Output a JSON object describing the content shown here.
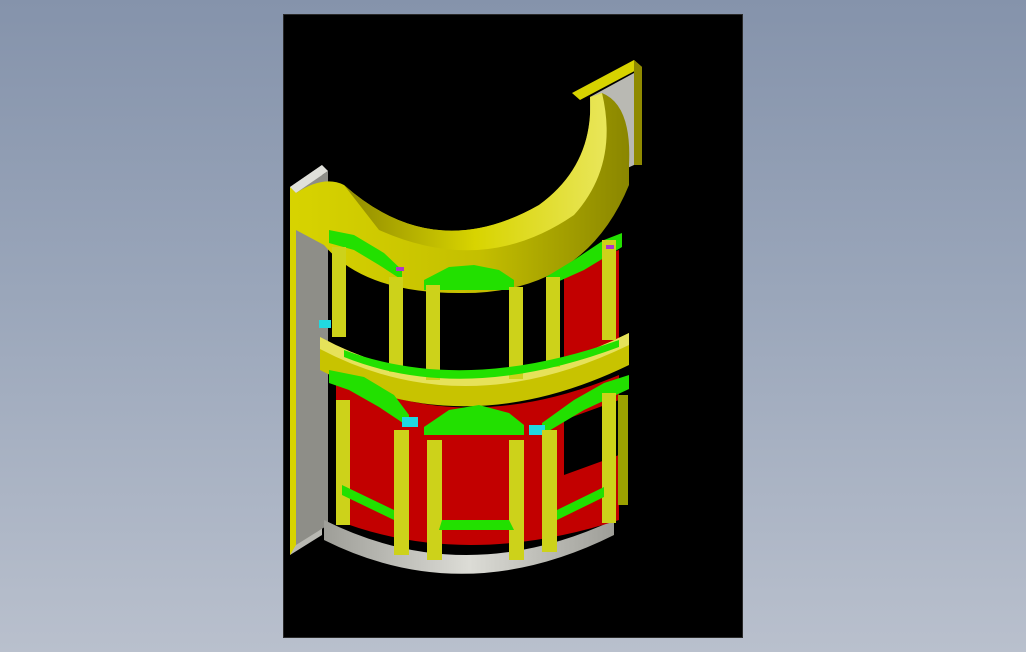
{
  "viewport": {
    "background_top": "#8593ab",
    "background_bottom": "#b9c0cd"
  },
  "sheet": {
    "background": "#000000"
  },
  "model": {
    "colors": {
      "wall": "#c8c300",
      "wall_shade": "#8f8a00",
      "wall_light": "#e6e25a",
      "side_wall": "#b9b9b3",
      "side_wall_dark": "#8e8e88",
      "base": "#d2d2cc",
      "base_dark": "#a6a6a0",
      "trim": "#22e000",
      "trim_dark": "#129300",
      "column": "#cdd21a",
      "column_dark": "#9ba000",
      "interior": "#c20000",
      "interior_dark": "#7f0000",
      "sill_cyan": "#20d8e0",
      "accent": "#ad37c8"
    }
  }
}
